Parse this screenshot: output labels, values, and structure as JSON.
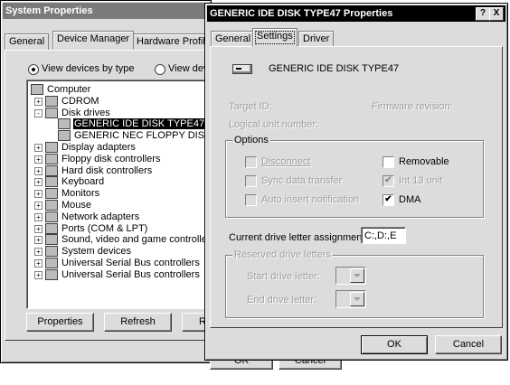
{
  "background_window": {
    "title": "System Properties",
    "tabs": [
      "General",
      "Device Manager",
      "Hardware Profiles"
    ],
    "view_by_type": "View devices by type",
    "view_by_connection": "View dev",
    "tree": [
      {
        "label": "Computer",
        "expander": "",
        "level": 0,
        "icon": "computer-icon"
      },
      {
        "label": "CDROM",
        "expander": "+",
        "level": 1,
        "icon": "cdrom-icon"
      },
      {
        "label": "Disk drives",
        "expander": "-",
        "level": 1,
        "icon": "disk-drives-icon"
      },
      {
        "label": "GENERIC IDE  DISK TYPE47",
        "expander": "",
        "level": 2,
        "icon": "hard-disk-icon",
        "selected": true
      },
      {
        "label": "GENERIC NEC  FLOPPY DISK",
        "expander": "",
        "level": 2,
        "icon": "floppy-disk-icon"
      },
      {
        "label": "Display adapters",
        "expander": "+",
        "level": 1,
        "icon": "display-adapter-icon"
      },
      {
        "label": "Floppy disk controllers",
        "expander": "+",
        "level": 1,
        "icon": "floppy-controller-icon"
      },
      {
        "label": "Hard disk controllers",
        "expander": "+",
        "level": 1,
        "icon": "hard-disk-controller-icon"
      },
      {
        "label": "Keyboard",
        "expander": "+",
        "level": 1,
        "icon": "keyboard-icon"
      },
      {
        "label": "Monitors",
        "expander": "+",
        "level": 1,
        "icon": "monitor-icon"
      },
      {
        "label": "Mouse",
        "expander": "+",
        "level": 1,
        "icon": "mouse-icon"
      },
      {
        "label": "Network adapters",
        "expander": "+",
        "level": 1,
        "icon": "network-adapter-icon"
      },
      {
        "label": "Ports (COM & LPT)",
        "expander": "+",
        "level": 1,
        "icon": "ports-icon"
      },
      {
        "label": "Sound, video and game controllers",
        "expander": "+",
        "level": 1,
        "icon": "sound-icon"
      },
      {
        "label": "System devices",
        "expander": "+",
        "level": 1,
        "icon": "system-devices-icon"
      },
      {
        "label": "Universal Serial Bus controllers",
        "expander": "+",
        "level": 1,
        "icon": "usb-icon"
      },
      {
        "label": "Universal Serial Bus controllers",
        "expander": "+",
        "level": 1,
        "icon": "usb-icon"
      }
    ],
    "buttons": {
      "properties": "Properties",
      "refresh": "Refresh",
      "remove_partial": "R"
    },
    "bottom_buttons": {
      "ok": "OK",
      "cancel": "Cancel"
    }
  },
  "dialog": {
    "title": "GENERIC IDE  DISK TYPE47 Properties",
    "help": "?",
    "close": "X",
    "tabs": [
      "General",
      "Settings",
      "Driver"
    ],
    "device_name": "GENERIC IDE  DISK TYPE47",
    "target_id": "Target ID:",
    "firmware_revision": "Firmware revision:",
    "logical_unit": "Logical unit number:",
    "options_label": "Options",
    "options": {
      "disconnect": {
        "label": "Disconnect",
        "checked": false,
        "enabled": false
      },
      "sync_data": {
        "label": "Sync data transfer",
        "checked": false,
        "enabled": false
      },
      "auto_insert": {
        "label": "Auto insert notification",
        "checked": false,
        "enabled": false
      },
      "removable": {
        "label": "Removable",
        "checked": false,
        "enabled": true
      },
      "int13": {
        "label": "Int 13 unit",
        "checked": true,
        "enabled": false
      },
      "dma": {
        "label": "DMA",
        "checked": true,
        "enabled": true
      }
    },
    "current_drive_label": "Current drive letter assignment:",
    "current_drive_value": "C:,D:,E",
    "reserved_label": "Reserved drive letters",
    "start_drive": "Start drive letter:",
    "end_drive": "End drive letter:",
    "ok": "OK",
    "cancel": "Cancel"
  }
}
